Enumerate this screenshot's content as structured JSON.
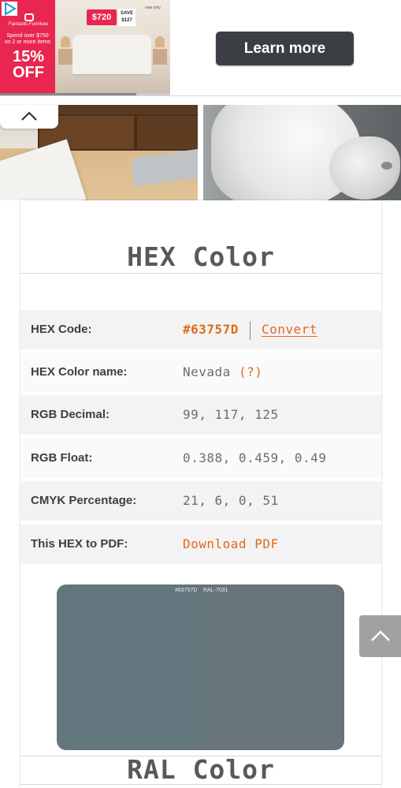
{
  "ad": {
    "brand": "Fantastic Furniture",
    "offer_line": "Spend over $750 on 2 or more items",
    "discount": "15% OFF",
    "price_prefix": "now only",
    "price": "$720",
    "save_label": "SAVE",
    "save_amount": "$127",
    "cta": "Learn more",
    "progress": 0.8
  },
  "hex_section": {
    "title": "HEX Color",
    "rows": [
      {
        "label": "HEX Code:",
        "value": "#63757D",
        "link": "Convert"
      },
      {
        "label": "HEX Color name:",
        "value": "Nevada",
        "link": "(?)"
      },
      {
        "label": "RGB Decimal:",
        "value": "99, 117, 125"
      },
      {
        "label": "RGB Float:",
        "value": "0.388, 0.459, 0.49"
      },
      {
        "label": "CMYK Percentage:",
        "value": "21, 6, 0, 51"
      },
      {
        "label": "This HEX to PDF:",
        "value": "Download PDF"
      }
    ]
  },
  "swatch": {
    "left_label": "#63757D",
    "right_label": "RAL-7031",
    "left_color": "#63757D",
    "right_color": "#677479"
  },
  "ral_section": {
    "title": "RAL Color"
  },
  "colors": {
    "accent": "#E06B1B",
    "ad_brand": "#E8264F",
    "cta_bg": "#3B3F44"
  }
}
